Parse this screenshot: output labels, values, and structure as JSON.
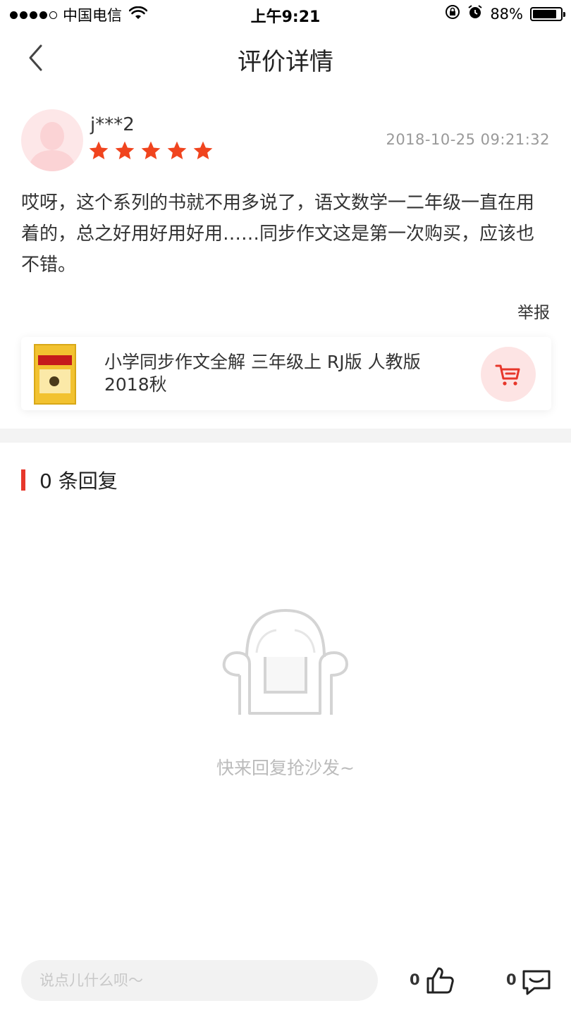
{
  "status_bar": {
    "carrier": "中国电信",
    "time": "上午9:21",
    "battery": "88%",
    "battery_level": 0.88
  },
  "nav": {
    "title": "评价详情",
    "back_icon": "chevron-left-icon"
  },
  "review": {
    "username": "j***2",
    "rating": 5,
    "rating_max": 5,
    "timestamp": "2018-10-25 09:21:32",
    "text": "哎呀，这个系列的书就不用多说了，语文数学一二年级一直在用着的，总之好用好用好用……同步作文这是第一次购买，应该也不错。",
    "report_label": "举报"
  },
  "product": {
    "title": "小学同步作文全解 三年级上 RJ版 人教版 2018秋",
    "cart_icon": "cart-icon"
  },
  "replies": {
    "header": "0 条回复",
    "empty_text": "快来回复抢沙发~",
    "empty_icon": "sofa-icon"
  },
  "bottom_bar": {
    "input_placeholder": "说点儿什么呗～",
    "like_count": "0",
    "comment_count": "0"
  },
  "colors": {
    "accent": "#e7372b",
    "star": "#f0441e",
    "cart_bg": "#fde4e4",
    "muted_text": "#999999"
  }
}
